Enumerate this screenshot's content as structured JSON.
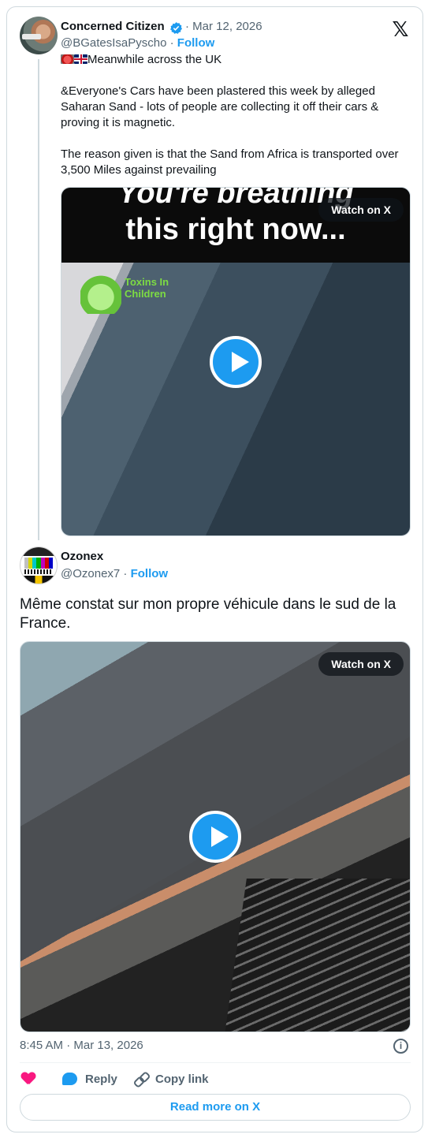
{
  "tweet1": {
    "author_name": "Concerned Citizen",
    "separator": " · ",
    "date": "Mar 12, 2026",
    "handle": "@BGatesIsaPyscho",
    "follow_label": "Follow",
    "first_line": "Meanwhile across the UK",
    "body": "&Everyone's Cars have been plastered this week by alleged Saharan Sand - lots of people are collecting it off their cars & proving it is magnetic.\n\nThe reason given is that the Sand from Africa is transported over 3,500 Miles against prevailing",
    "media": {
      "caption_line1": "You're breathing",
      "caption_line2": "this right now...",
      "logo_text": "Toxins In Children",
      "watch_label": "Watch on X"
    }
  },
  "tweet2": {
    "author_name": "Ozonex",
    "handle": "@Ozonex7",
    "separator": " · ",
    "follow_label": "Follow",
    "body": "Même constat sur mon propre véhicule dans le sud de la France.",
    "media": {
      "watch_label": "Watch on X"
    }
  },
  "footer": {
    "timestamp": "8:45 AM · Mar 13, 2026",
    "reply_label": "Reply",
    "copy_label": "Copy link",
    "read_more_label": "Read more on X"
  },
  "colors": {
    "accent": "#1d9bf0",
    "like": "#f91880",
    "text": "#0f1419",
    "muted": "#536471"
  },
  "icons": [
    "verified-icon",
    "x-logo-icon",
    "play-icon",
    "info-icon",
    "heart-icon",
    "reply-icon",
    "link-icon"
  ]
}
